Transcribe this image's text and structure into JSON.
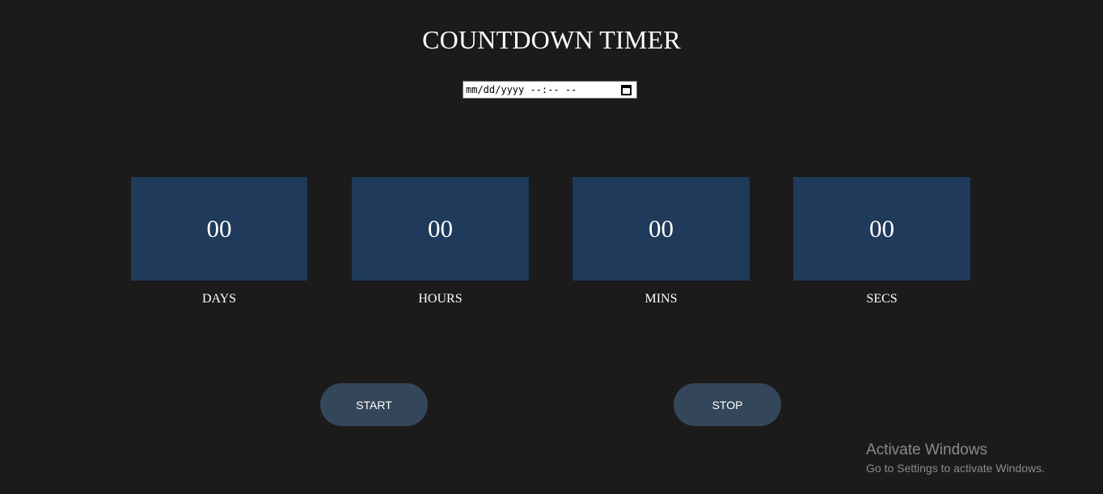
{
  "header": {
    "title": "COUNTDOWN TIMER"
  },
  "date_input": {
    "display_value": "mm/dd/yyyy --:-- --",
    "icon": "calendar-icon"
  },
  "timer": {
    "units": [
      {
        "value": "00",
        "label": "DAYS"
      },
      {
        "value": "00",
        "label": "HOURS"
      },
      {
        "value": "00",
        "label": "MINS"
      },
      {
        "value": "00",
        "label": "SECS"
      }
    ]
  },
  "controls": {
    "start_label": "START",
    "stop_label": "STOP"
  },
  "watermark": {
    "title": "Activate Windows",
    "subtitle": "Go to Settings to activate Windows."
  },
  "colors": {
    "background": "#1b1b1b",
    "box": "#1f3a5a",
    "button": "#34475a",
    "text": "#ffffff"
  }
}
